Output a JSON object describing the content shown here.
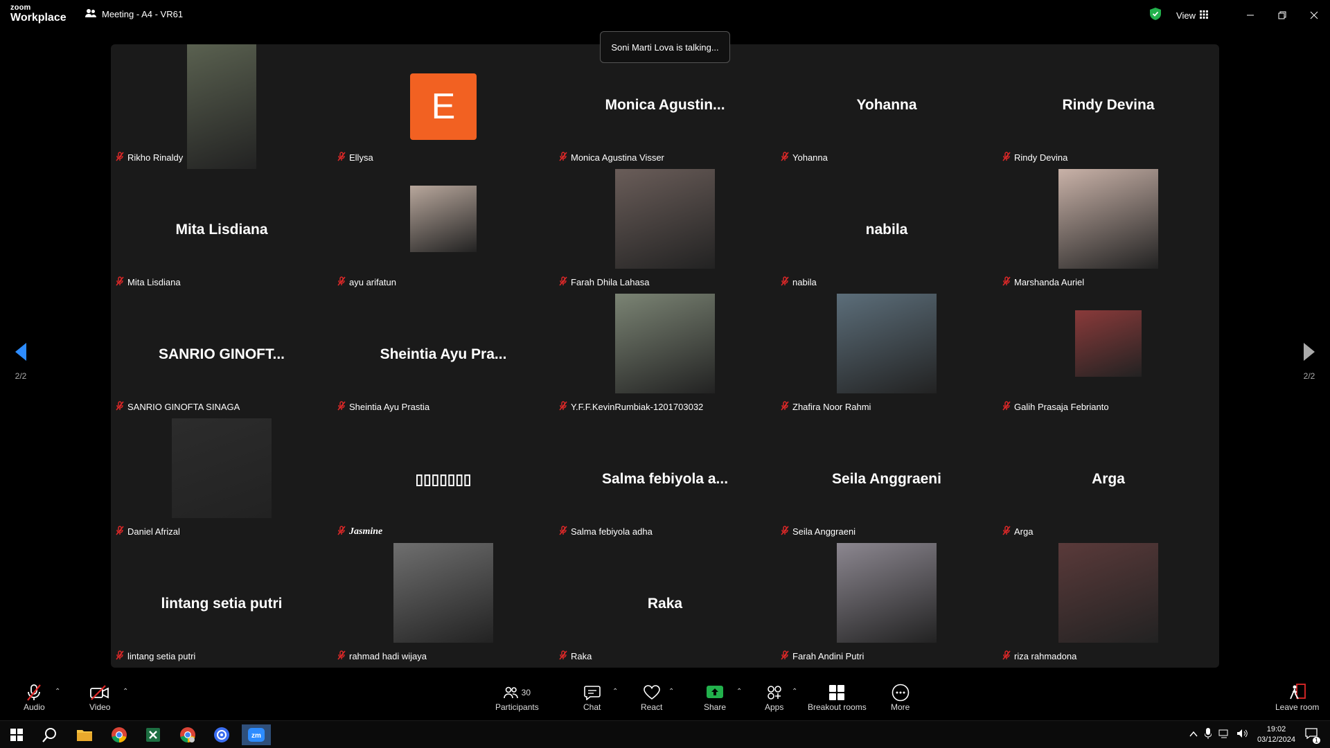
{
  "titlebar": {
    "brand_top": "zoom",
    "brand_bottom": "Workplace",
    "meeting_title": "Meeting - A4 - VR61",
    "view_label": "View"
  },
  "toast": "Soni Marti Lova is talking...",
  "pager": {
    "left": "2/2",
    "right": "2/2"
  },
  "tiles": [
    {
      "label": "Rikho Rinaldy",
      "big": "",
      "photo": "#5a6150"
    },
    {
      "label": "Ellysa",
      "big": "",
      "avatar": "E"
    },
    {
      "label": "Monica Agustina Visser",
      "big": "Monica  Agustin..."
    },
    {
      "label": "Yohanna",
      "big": "Yohanna"
    },
    {
      "label": "Rindy Devina",
      "big": "Rindy Devina"
    },
    {
      "label": "Mita Lisdiana",
      "big": "Mita Lisdiana"
    },
    {
      "label": "ayu arifatun",
      "big": "",
      "photo": "#b8a79c",
      "small": true
    },
    {
      "label": "Farah Dhila Lahasa",
      "big": "",
      "photo": "#6a5d59"
    },
    {
      "label": "nabila",
      "big": "nabila"
    },
    {
      "label": "Marshanda Auriel",
      "big": "",
      "photo": "#c9b2a8"
    },
    {
      "label": "SANRIO GINOFTA SINAGA",
      "big": "SANRIO  GINOFT..."
    },
    {
      "label": "Sheintia Ayu Prastia",
      "big": "Sheintia  Ayu  Pra..."
    },
    {
      "label": "Y.F.F.KevinRumbiak-1201703032",
      "big": "",
      "photo": "#7b8474"
    },
    {
      "label": "Zhafira Noor Rahmi",
      "big": "",
      "photo": "#5c6e7a"
    },
    {
      "label": "Galih Prasaja Febrianto",
      "big": "",
      "photo": "#8a3a3a",
      "small": true
    },
    {
      "label": "Daniel Afrizal",
      "big": "",
      "photo": "#2c2c2c"
    },
    {
      "label": "Jasmine",
      "big": "▯▯▯▯▯▯▯",
      "italic": true
    },
    {
      "label": "Salma febiyola adha",
      "big": "Salma  febiyola  a..."
    },
    {
      "label": "Seila Anggraeni",
      "big": "Seila Anggraeni"
    },
    {
      "label": "Arga",
      "big": "Arga"
    },
    {
      "label": "lintang setia putri",
      "big": "lintang setia putri"
    },
    {
      "label": "rahmad hadi wijaya",
      "big": "",
      "photo": "#6f6f6f"
    },
    {
      "label": "Raka",
      "big": "Raka"
    },
    {
      "label": "Farah Andini Putri",
      "big": "",
      "photo": "#8c8790"
    },
    {
      "label": "riza rahmadona",
      "big": "",
      "photo": "#5a3a3a"
    }
  ],
  "toolbar": {
    "audio": "Audio",
    "video": "Video",
    "participants": "Participants",
    "participants_count": "30",
    "chat": "Chat",
    "react": "React",
    "share": "Share",
    "apps": "Apps",
    "breakout": "Breakout rooms",
    "more": "More",
    "leave": "Leave room"
  },
  "taskbar": {
    "time": "19:02",
    "date": "03/12/2024",
    "notif": "1"
  },
  "colors": {
    "accent_orange": "#f26122",
    "mute_red": "#e02828",
    "share_green": "#22b14c",
    "pager_blue": "#2d8cff"
  }
}
